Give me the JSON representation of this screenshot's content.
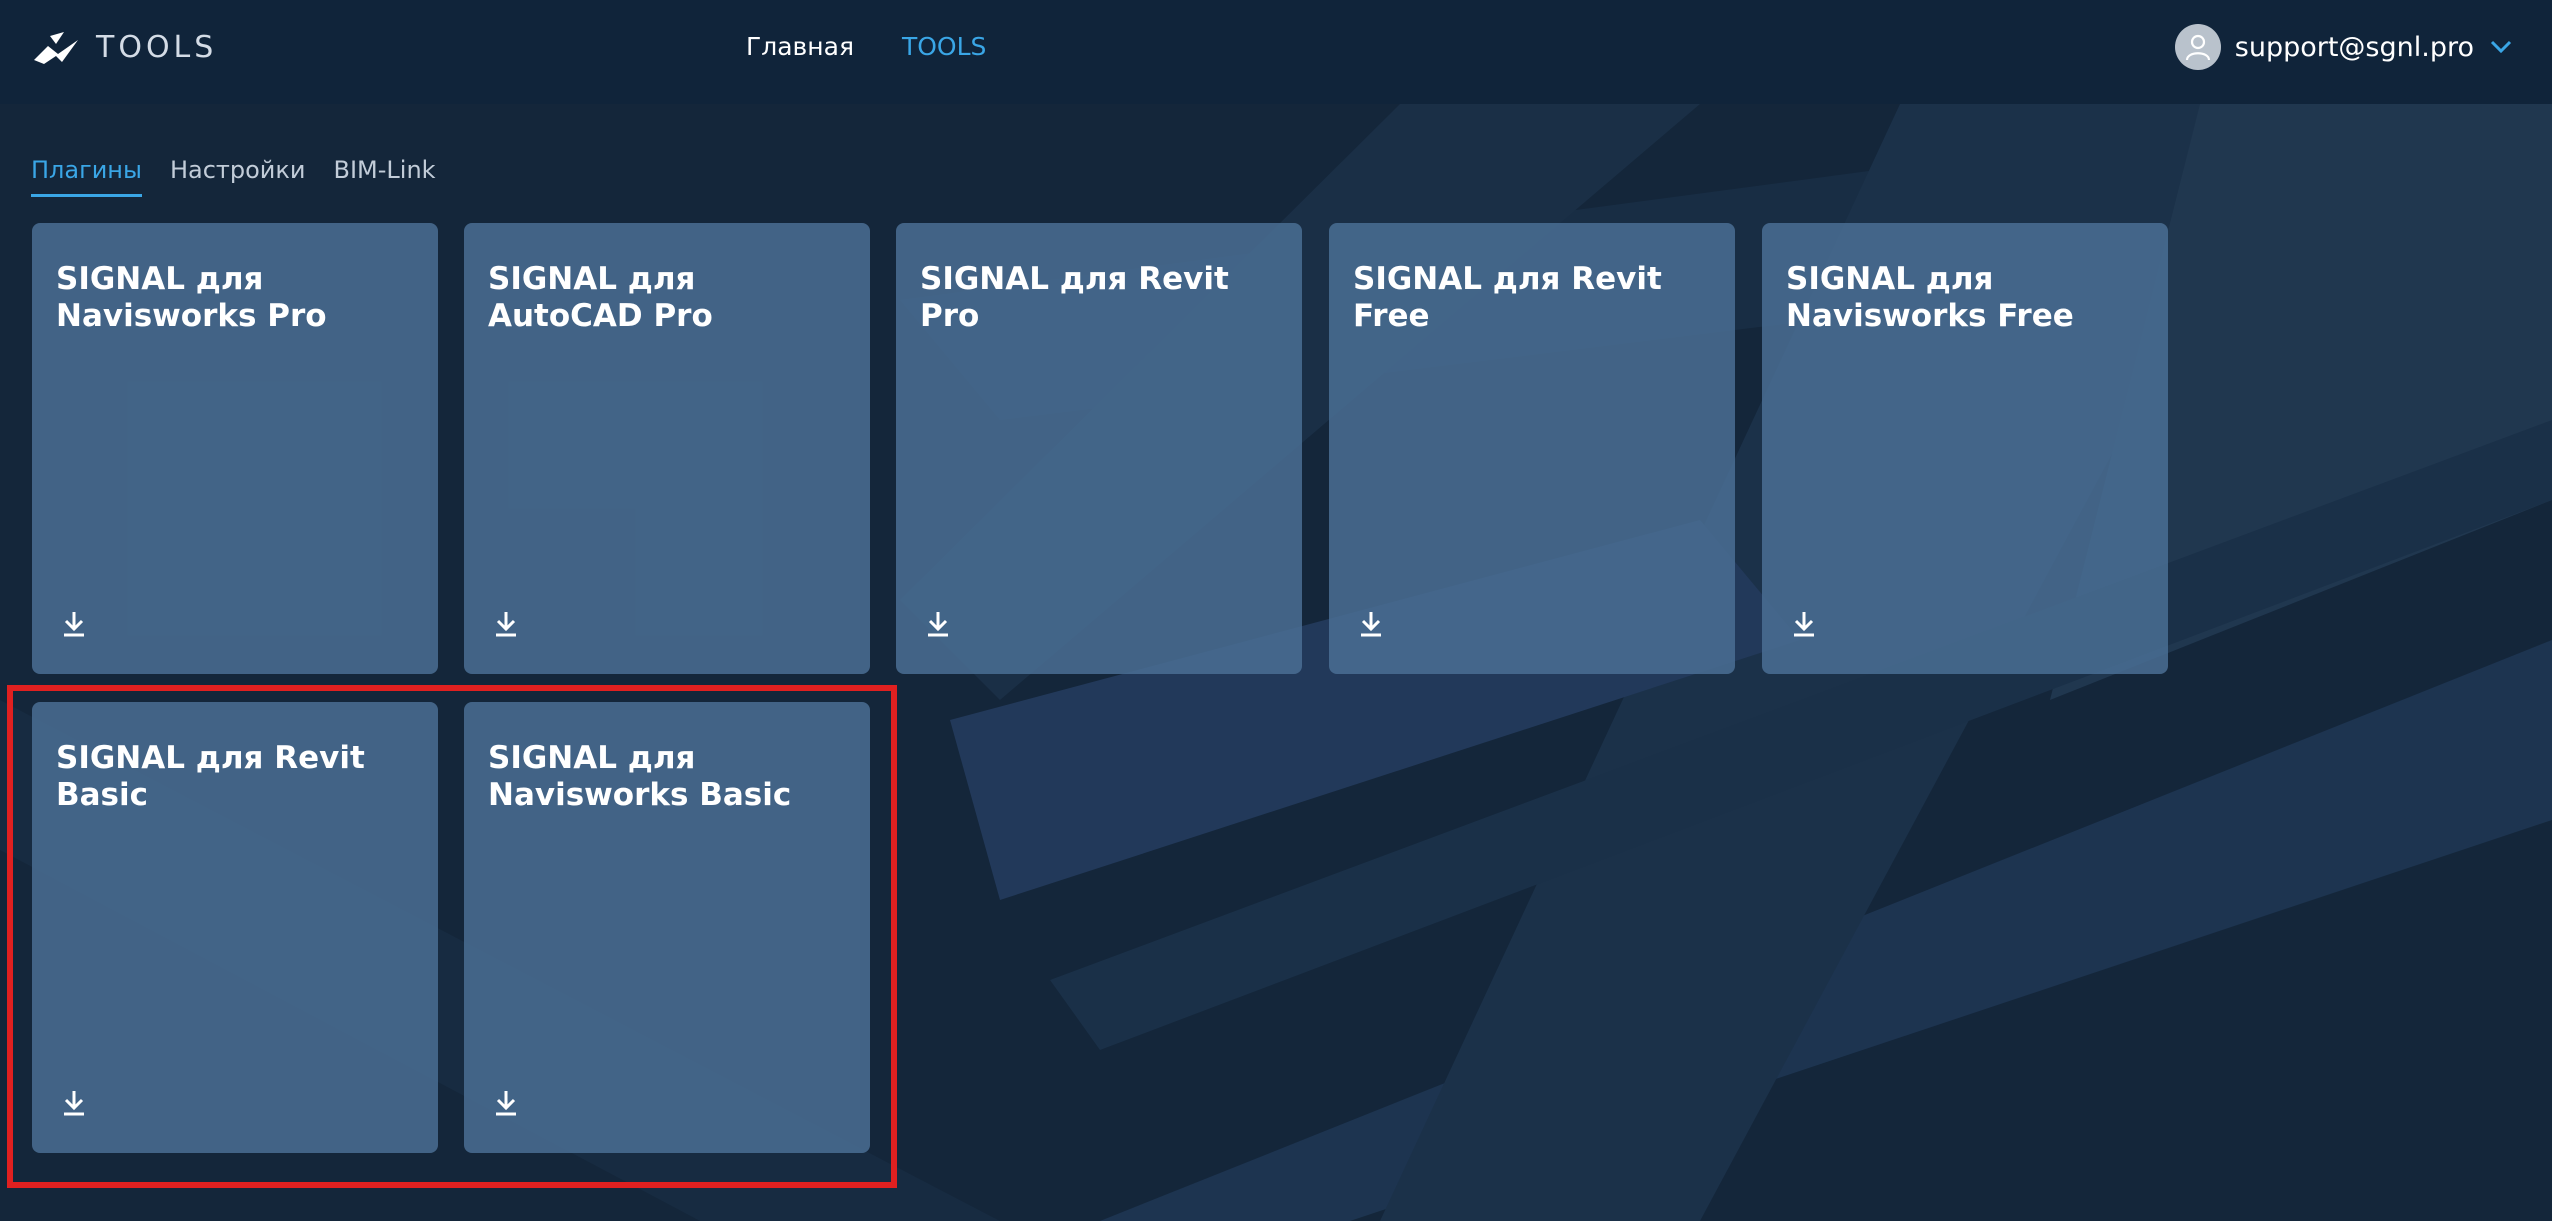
{
  "header": {
    "logo_text": "TOOLS",
    "nav": [
      {
        "label": "Главная",
        "active": false
      },
      {
        "label": "TOOLS",
        "active": true
      }
    ],
    "user_email": "support@sgnl.pro"
  },
  "tabs": [
    {
      "label": "Плагины",
      "active": true
    },
    {
      "label": "Настройки",
      "active": false
    },
    {
      "label": "BIM-Link",
      "active": false
    }
  ],
  "cards": [
    {
      "title": "SIGNAL для Navisworks Pro",
      "icon": "download-icon"
    },
    {
      "title": "SIGNAL для AutoCAD Pro",
      "icon": "download-icon"
    },
    {
      "title": "SIGNAL для Revit Pro",
      "icon": "download-icon"
    },
    {
      "title": "SIGNAL для Revit Free",
      "icon": "download-icon"
    },
    {
      "title": "SIGNAL для Navisworks Free",
      "icon": "download-icon"
    },
    {
      "title": "SIGNAL для Revit Basic",
      "icon": "download-icon"
    },
    {
      "title": "SIGNAL для Navisworks Basic",
      "icon": "download-icon"
    }
  ],
  "colors": {
    "background": "#14263a",
    "header": "#10243a",
    "accent": "#3aa6e6",
    "card": "#4a6f94",
    "highlight": "#e02020"
  }
}
